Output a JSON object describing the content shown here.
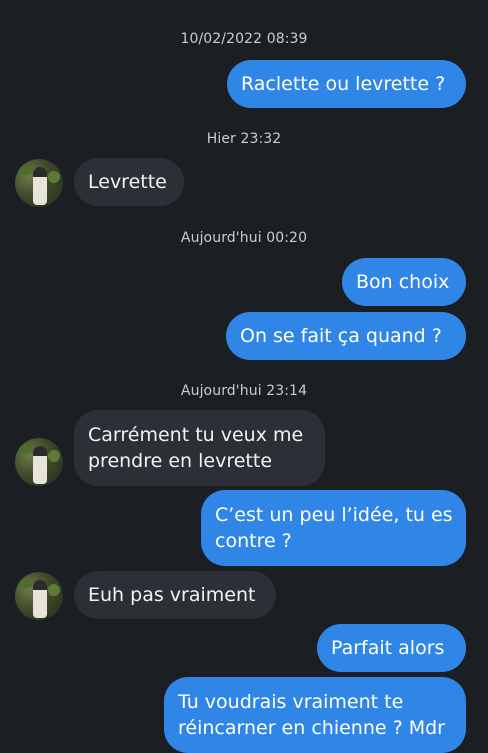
{
  "thread": {
    "timestamps": [
      "10/02/2022 08:39",
      "Hier 23:32",
      "Aujourd'hui 00:20",
      "Aujourd'hui 23:14"
    ],
    "messages": [
      {
        "direction": "outgoing",
        "text": "Raclette ou levrette ?"
      },
      {
        "direction": "incoming",
        "text": "Levrette"
      },
      {
        "direction": "outgoing",
        "text": "Bon choix"
      },
      {
        "direction": "outgoing",
        "text": "On se fait ça quand ?"
      },
      {
        "direction": "incoming",
        "lines": [
          "Carrément tu veux me",
          "prendre en levrette"
        ]
      },
      {
        "direction": "outgoing",
        "lines": [
          "C’est un peu l’idée, tu es",
          "contre ?"
        ]
      },
      {
        "direction": "incoming",
        "text": "Euh pas vraiment"
      },
      {
        "direction": "outgoing",
        "text": "Parfait alors"
      },
      {
        "direction": "outgoing",
        "lines": [
          "Tu voudrais vraiment te",
          "réincarner en chienne ? Mdr"
        ]
      }
    ]
  },
  "colors": {
    "background": "#1b1e22",
    "outgoing_bubble": "#2f86e6",
    "incoming_bubble": "#2c3036",
    "timestamp_text": "#c9ccd1"
  },
  "icons": {
    "avatar": "contact-avatar"
  }
}
